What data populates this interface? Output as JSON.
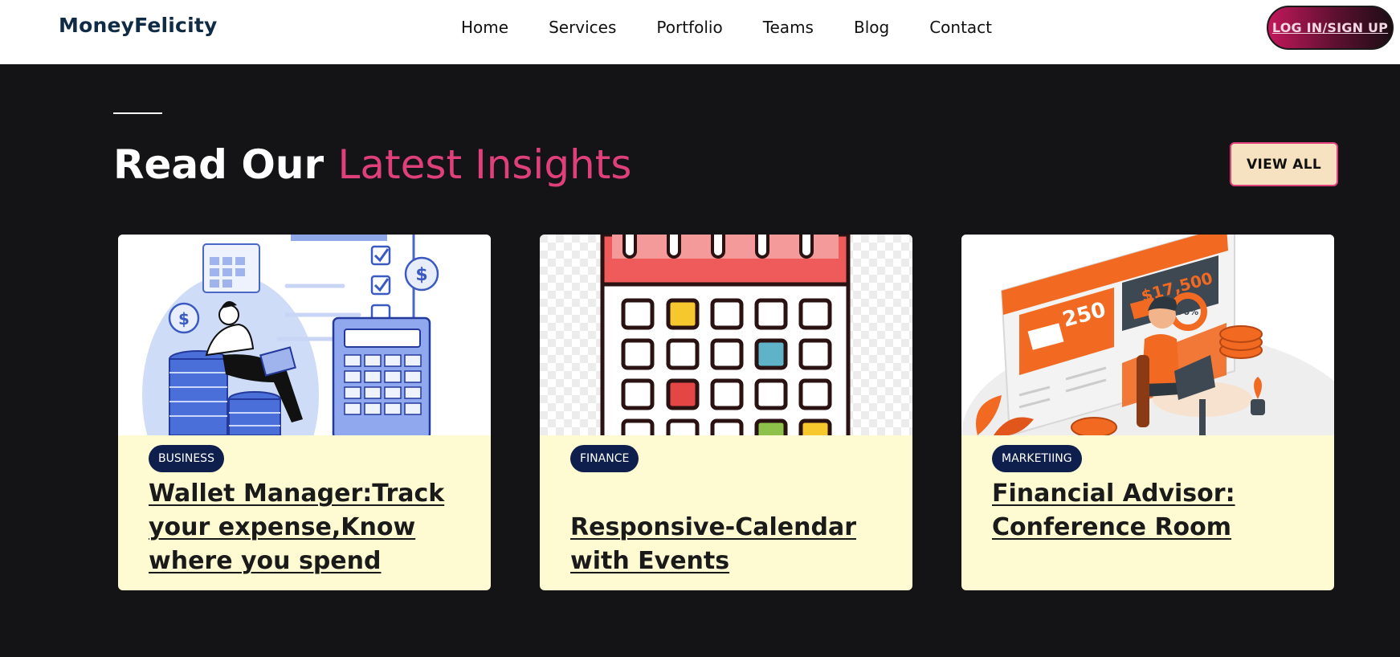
{
  "header": {
    "brand": "MoneyFelicity",
    "nav": [
      "Home",
      "Services",
      "Portfolio",
      "Teams",
      "Blog",
      "Contact"
    ],
    "login_label": "LOG IN/SIGN UP"
  },
  "section": {
    "title_plain": "Read Our ",
    "title_accent": "Latest Insights",
    "view_all_label": "VIEW ALL"
  },
  "cards": [
    {
      "category": "BUSINESS",
      "title": "Wallet Manager:Track your expense,Know where you spend",
      "image_icon": "finance-illustration"
    },
    {
      "category": "FINANCE",
      "title": "Responsive-Calendar with Events",
      "image_icon": "calendar-illustration"
    },
    {
      "category": "MARKETIING",
      "title": "Financial Advisor: Conference Room",
      "image_icon": "advisor-illustration"
    }
  ],
  "colors": {
    "accent": "#e0407a",
    "badge": "#0e1f4d",
    "card_bg": "#fefad1",
    "page_bg": "#141416"
  }
}
